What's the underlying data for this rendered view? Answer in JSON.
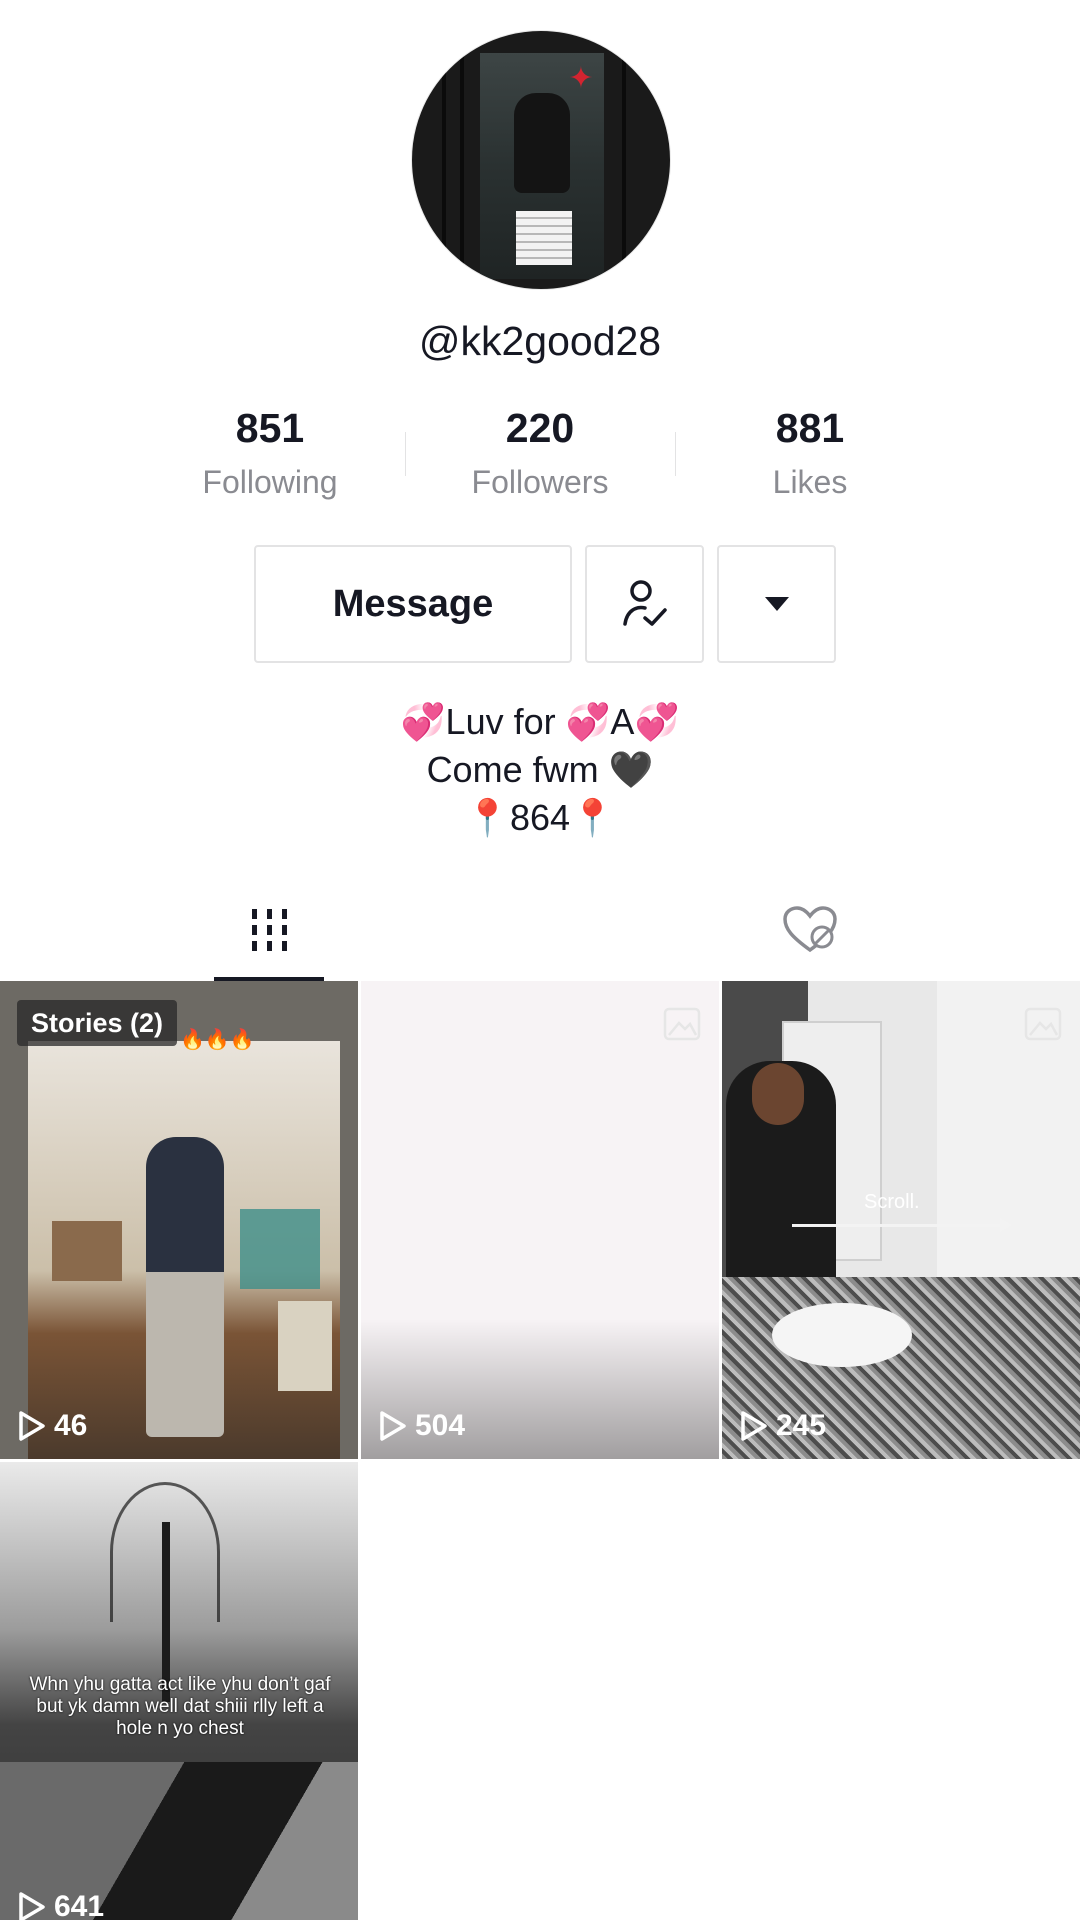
{
  "profile": {
    "username": "@kk2good28"
  },
  "stats": [
    {
      "value": "851",
      "label": "Following"
    },
    {
      "value": "220",
      "label": "Followers"
    },
    {
      "value": "881",
      "label": "Likes"
    }
  ],
  "actions": {
    "message_label": "Message",
    "friend_icon": "user-check-icon",
    "more_icon": "caret-down-icon"
  },
  "bio": {
    "line1": "💞Luv for 💞A💞",
    "line2": "Come fwm 🖤",
    "line3": "📍864📍"
  },
  "tabs": [
    {
      "icon": "videos-grid-icon",
      "selected": true
    },
    {
      "icon": "liked-heart-hidden-icon",
      "selected": false
    }
  ],
  "videos": [
    {
      "views": "46",
      "badge": "Stories (2)",
      "overlay_text": "🔥🔥🔥"
    },
    {
      "views": "504"
    },
    {
      "views": "245",
      "overlay_text": "Scroll."
    },
    {
      "views": "641",
      "overlay_text": "Whn yhu gatta act like yhu don’t gaf but yk damn well dat shiii rlly left a hole n yo chest"
    }
  ],
  "colors": {
    "text_primary": "#161823",
    "text_secondary": "#8a8b91",
    "border": "#e3e3e4"
  }
}
